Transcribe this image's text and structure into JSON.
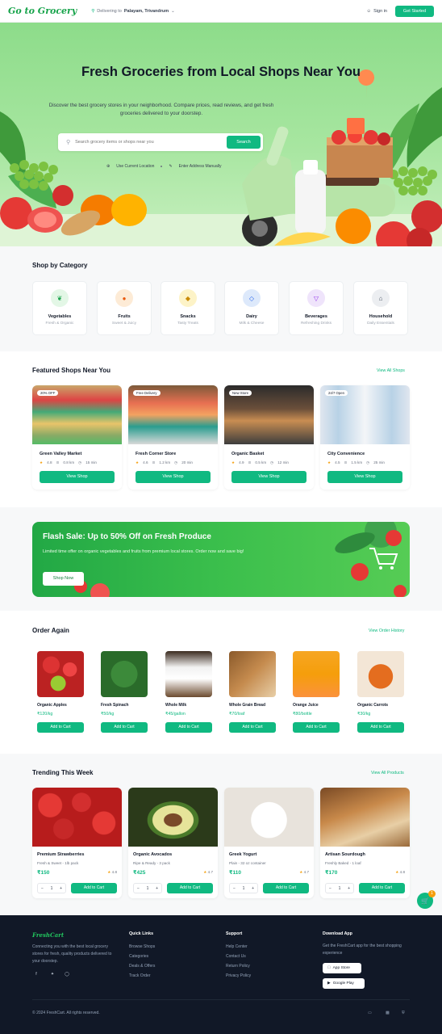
{
  "header": {
    "logo": "Go to Grocery",
    "delivering_prefix": "Delivering to",
    "location": "Palayam, Trivandrum",
    "signin": "Sign in",
    "get_started": "Get Started"
  },
  "hero": {
    "title": "Fresh Groceries from Local Shops Near You",
    "subtitle": "Discover the best grocery stores in your neighborhood. Compare prices, read reviews, and get fresh groceries delivered to your doorstep.",
    "search_placeholder": "Search grocery items or shops near you",
    "search_button": "Search",
    "use_location": "Use Current Location",
    "enter_address": "Enter Address Manually"
  },
  "categories": {
    "title": "Shop by Category",
    "items": [
      {
        "name": "Vegetables",
        "sub": "Fresh & Organic",
        "icon": "leaf-icon",
        "bg": "#e3f7e6",
        "fg": "#16a34a"
      },
      {
        "name": "Fruits",
        "sub": "Sweet & Juicy",
        "icon": "apple-icon",
        "bg": "#fdebd6",
        "fg": "#ea580c"
      },
      {
        "name": "Snacks",
        "sub": "Tasty Treats",
        "icon": "snack-icon",
        "bg": "#fdf3c7",
        "fg": "#ca8a04"
      },
      {
        "name": "Dairy",
        "sub": "Milk & Cheese",
        "icon": "milk-drop-icon",
        "bg": "#dde9fb",
        "fg": "#2563eb"
      },
      {
        "name": "Beverages",
        "sub": "Refreshing Drinks",
        "icon": "cup-icon",
        "bg": "#efe4fb",
        "fg": "#9333ea"
      },
      {
        "name": "Household",
        "sub": "Daily Essentials",
        "icon": "home-icon",
        "bg": "#eceef1",
        "fg": "#4b5563"
      }
    ]
  },
  "featured": {
    "title": "Featured Shops Near You",
    "view_all": "View All Shops",
    "shops": [
      {
        "tag": "20% OFF",
        "name": "Green Valley Market",
        "rating": "4.8",
        "distance": "0.8 km",
        "time": "15 min",
        "button": "View Shop"
      },
      {
        "tag": "Free Delivery",
        "name": "Fresh Corner Store",
        "rating": "4.6",
        "distance": "1.2 km",
        "time": "20 min",
        "button": "View Shop"
      },
      {
        "tag": "New Store",
        "name": "Organic Basket",
        "rating": "4.9",
        "distance": "0.5 km",
        "time": "12 min",
        "button": "View Shop"
      },
      {
        "tag": "24/7 Open",
        "name": "City Convenience",
        "rating": "4.5",
        "distance": "1.5 km",
        "time": "25 min",
        "button": "View Shop"
      }
    ]
  },
  "flash": {
    "title": "Flash Sale: Up to 50% Off on Fresh Produce",
    "text": "Limited time offer on organic vegetables and fruits from premium local stores. Order now and save big!",
    "button": "Shop Now"
  },
  "order_again": {
    "title": "Order Again",
    "view_all": "View Order History",
    "items": [
      {
        "name": "Organic Apples",
        "price": "₹120/kg",
        "button": "Add to Cart"
      },
      {
        "name": "Fresh Spinach",
        "price": "₹50/kg",
        "button": "Add to Cart"
      },
      {
        "name": "Whole Milk",
        "price": "₹45/gallon",
        "button": "Add to Cart"
      },
      {
        "name": "Whole Grain Bread",
        "price": "₹70/loaf",
        "button": "Add to Cart"
      },
      {
        "name": "Orange Juice",
        "price": "₹80/bottle",
        "button": "Add to Cart"
      },
      {
        "name": "Organic Carrots",
        "price": "₹30/kg",
        "button": "Add to Cart"
      }
    ]
  },
  "trending": {
    "title": "Trending This Week",
    "view_all": "View All Products",
    "items": [
      {
        "name": "Premium Strawberries",
        "desc": "Fresh & Sweet - 1lb pack",
        "price": "₹150",
        "rating": "4.8",
        "qty": "1",
        "button": "Add to Cart"
      },
      {
        "name": "Organic Avocados",
        "desc": "Ripe & Ready - 3 pack",
        "price": "₹425",
        "rating": "4.7",
        "qty": "1",
        "button": "Add to Cart"
      },
      {
        "name": "Greek Yogurt",
        "desc": "Plain - 32 oz container",
        "price": "₹110",
        "rating": "4.7",
        "qty": "1",
        "button": "Add to Cart"
      },
      {
        "name": "Artisan Sourdough",
        "desc": "Freshly Baked - 1 loaf",
        "price": "₹170",
        "rating": "4.8",
        "qty": "1",
        "button": "Add to Cart"
      }
    ]
  },
  "footer": {
    "brand": "FreshCart",
    "tagline": "Connecting you with the best local grocery stores for fresh, quality products delivered to your doorstep.",
    "quick_links_title": "Quick Links",
    "quick_links": [
      "Browse Shops",
      "Categories",
      "Deals & Offers",
      "Track Order"
    ],
    "support_title": "Support",
    "support_links": [
      "Help Center",
      "Contact Us",
      "Return Policy",
      "Privacy Policy"
    ],
    "download_title": "Download App",
    "download_text": "Get the FreshCart app for the best shopping experience",
    "app_store": "App Store",
    "google_play": "Google Play",
    "copyright": "© 2024 FreshCart. All rights reserved."
  },
  "cart": {
    "count": "1"
  }
}
